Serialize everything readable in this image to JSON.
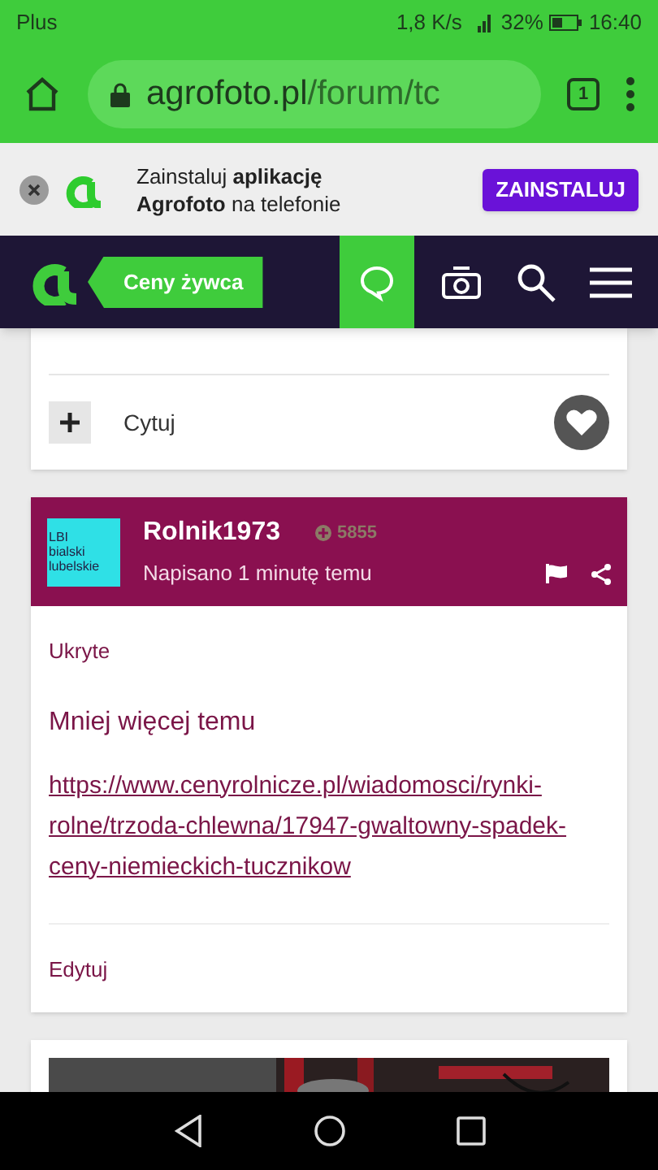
{
  "status_bar": {
    "carrier": "Plus",
    "speed": "1,8 K/s",
    "battery": "32%",
    "time": "16:40"
  },
  "browser": {
    "url_domain": "agrofoto.pl",
    "url_path": "/forum/tc",
    "tab_count": "1"
  },
  "app_banner": {
    "lines": [
      "Zainstaluj **aplikację**",
      "**Agrofoto** na telefonie"
    ],
    "button": "ZAINSTALUJ"
  },
  "site_nav": {
    "badge": "Ceny żywca",
    "items": [
      {
        "kind": "chat",
        "selected": true
      },
      {
        "kind": "camera",
        "selected": false
      },
      {
        "kind": "search",
        "selected": false
      },
      {
        "kind": "menu",
        "selected": false
      }
    ]
  },
  "previous_post": {
    "quote": "Cytuj"
  },
  "post": {
    "avatar_lines": [
      "LBI",
      "bialski",
      "lubelskie"
    ],
    "author": "Rolnik1973",
    "points": "5855",
    "time": "Napisano 1 minutę temu",
    "tag": "Ukryte",
    "body": "Mniej więcej temu",
    "link": "https://www.cenyrolnicze.pl/wiadomosci/rynki-rolne/trzoda-chlewna/17947-gwaltowny-spadek-ceny-niemieckich-tucznikow",
    "edit": "Edytuj"
  }
}
